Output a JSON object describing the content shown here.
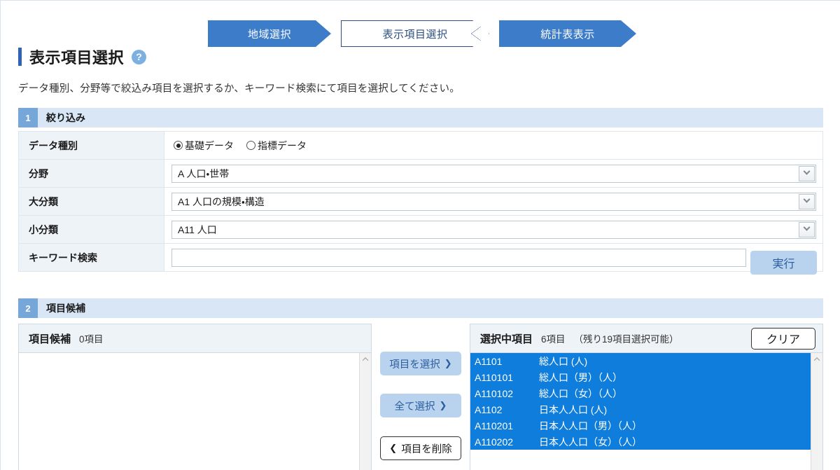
{
  "steps": [
    {
      "label": "地域選択",
      "state": "done"
    },
    {
      "label": "表示項目選択",
      "state": "current"
    },
    {
      "label": "統計表表示",
      "state": "upcoming"
    }
  ],
  "header": {
    "title": "表示項目選択",
    "help_icon": "help-circle-icon",
    "help_label": "?",
    "lead": "データ種別、分野等で絞込み項目を選択するか、キーワード検索にて項目を選択してください。"
  },
  "section1": {
    "number": "1",
    "title": "絞り込み",
    "rows": {
      "datatype": {
        "label": "データ種別",
        "options": [
          {
            "label": "基礎データ",
            "selected": true
          },
          {
            "label": "指標データ",
            "selected": false
          }
        ]
      },
      "field": {
        "label": "分野",
        "value": "A 人口・世帯"
      },
      "major": {
        "label": "大分類",
        "value": "A1 人口の規模・構造"
      },
      "minor": {
        "label": "小分類",
        "value": "A11 人口"
      },
      "keyword": {
        "label": "キーワード検索",
        "value": "",
        "placeholder": ""
      }
    },
    "execute_label": "実行"
  },
  "section2": {
    "number": "2",
    "title": "項目候補",
    "left_panel": {
      "title": "項目候補",
      "count": "0項目",
      "items": []
    },
    "transfer": {
      "select_items": "項目を選択",
      "select_all": "全て選択",
      "remove_items": "項目を削除",
      "arrow_right": "❯",
      "arrow_left": "❮"
    },
    "right_panel": {
      "title": "選択中項目",
      "count": "6項目",
      "remaining": "（残り19項目選択可能）",
      "clear_label": "クリア",
      "items": [
        {
          "code": "A1101",
          "name": "総人口 (人)"
        },
        {
          "code": "A110101",
          "name": "総人口（男）（人）"
        },
        {
          "code": "A110102",
          "name": "総人口（女）（人）"
        },
        {
          "code": "A1102",
          "name": "日本人人口 (人)"
        },
        {
          "code": "A110201",
          "name": "日本人人口（男）（人）"
        },
        {
          "code": "A110202",
          "name": "日本人人口（女）（人）"
        }
      ]
    }
  },
  "colors": {
    "step_blue": "#3d7cc9",
    "accent": "#2f63b5",
    "section_head": "#d8e6f5",
    "selection_blue": "#0f7ddb",
    "button_blue": "#b9d3ef"
  }
}
